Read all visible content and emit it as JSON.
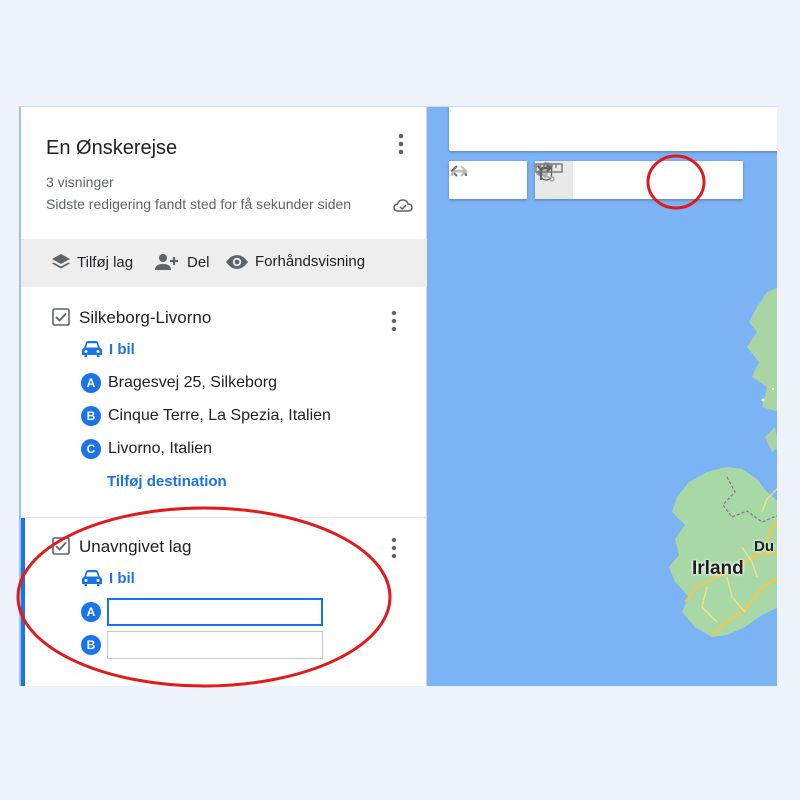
{
  "map_title": "En Ønskerejse",
  "views": "3 visninger",
  "last_edit": "Sidste redigering fandt sted for få sekunder siden",
  "actions": {
    "add_layer": "Tilføj lag",
    "share": "Del",
    "preview": "Forhåndsvisning"
  },
  "layers": [
    {
      "name": "Silkeborg-Livorno",
      "mode": "I bil",
      "destinations": [
        {
          "badge": "A",
          "text": "Bragesvej 25, Silkeborg"
        },
        {
          "badge": "B",
          "text": "Cinque Terre, La Spezia, Italien"
        },
        {
          "badge": "C",
          "text": "Livorno, Italien"
        }
      ],
      "add_destination": "Tilføj destination"
    },
    {
      "name": "Unavngivet lag",
      "mode": "I bil",
      "inputs": [
        {
          "badge": "A",
          "value": ""
        },
        {
          "badge": "B",
          "value": ""
        }
      ]
    }
  ],
  "map": {
    "label_country": "Irland",
    "label_city_partial": "Du"
  },
  "colors": {
    "accent": "#1a73e8",
    "water": "#7cb3f5",
    "land": "#a8d8a6",
    "annotation": "#e01b1b"
  },
  "icons": {
    "toolbar": [
      "undo-icon",
      "redo-icon",
      "hand-icon",
      "marker-icon",
      "draw-line-icon",
      "directions-icon",
      "ruler-icon"
    ]
  }
}
